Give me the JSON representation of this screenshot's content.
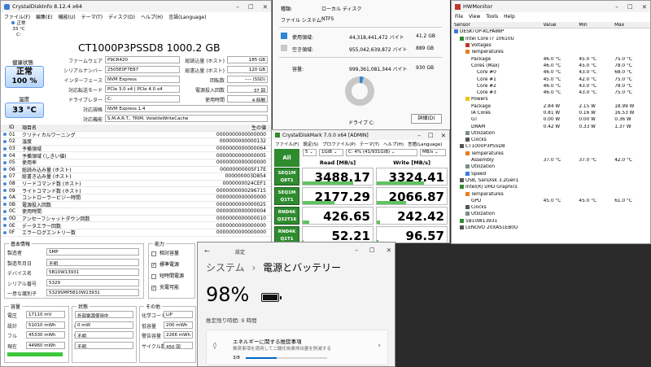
{
  "cdi": {
    "title": "CrystalDiskInfo 8.12.4 x64",
    "menu": [
      "ファイル(F)",
      "編集(E)",
      "機能(U)",
      "テーマ(T)",
      "ディスク(D)",
      "ヘルプ(H)",
      "言語(Language)"
    ],
    "drive_status": "正常",
    "drive_temp": "33 °C",
    "drive_letter": "C:",
    "model": "CT1000P3PSSD8 1000.2 GB",
    "health_label": "健康状態",
    "health_status": "正常",
    "health_pct": "100 %",
    "temp_label": "温度",
    "temp_value": "33 °C",
    "left_fields": [
      {
        "label": "ファームウェア",
        "value": "P9CR420"
      },
      {
        "label": "シリアルナンバー",
        "value": "2505E0F7E87"
      },
      {
        "label": "インターフェース",
        "value": "NVM Express"
      },
      {
        "label": "対応転送モード",
        "value": "PCIe 3.0 x4 | PCIe 4.0 x4"
      },
      {
        "label": "ドライブレター",
        "value": "C:"
      },
      {
        "label": "対応規格",
        "value": "NVM Express 1.4"
      },
      {
        "label": "対応機能",
        "value": "S.M.A.R.T., TRIM, VolatileWriteCache"
      }
    ],
    "right_fields": [
      {
        "label": "総読込量 (ホスト)",
        "value": "185 GB"
      },
      {
        "label": "総書込量 (ホスト)",
        "value": "120 GB"
      },
      {
        "label": "回転数",
        "value": "---- (SSD)"
      },
      {
        "label": "電源投入回数",
        "value": "37 回"
      },
      {
        "label": "使用時間",
        "value": "4 時間"
      }
    ],
    "attr_headers": [
      "ID",
      "項目名",
      "生の値"
    ],
    "attrs": [
      [
        "01",
        "クリティカルワーニング",
        "0000000000000000"
      ],
      [
        "02",
        "温度",
        "000000000000132"
      ],
      [
        "03",
        "予備領域",
        "0000000000000064"
      ],
      [
        "04",
        "予備領域 (しきい値)",
        "0000000000000005"
      ],
      [
        "05",
        "使用率",
        "0000000000000000"
      ],
      [
        "06",
        "総読み込み量 (ホスト)",
        "00000000005F17E"
      ],
      [
        "07",
        "総書き込み量 (ホスト)",
        "000000003D854"
      ],
      [
        "08",
        "リードコマンド数 (ホスト)",
        "0000000024CEF1"
      ],
      [
        "09",
        "ライトコマンド数 (ホスト)",
        "0000000000296715"
      ],
      [
        "0A",
        "コントローラービジー時間",
        "0000000000000000"
      ],
      [
        "0B",
        "電源投入回数",
        "0000000000000025"
      ],
      [
        "0C",
        "使用時間",
        "0000000000000004"
      ],
      [
        "0D",
        "アンセーフシャットダウン回数",
        "0000000000000010"
      ],
      [
        "0E",
        "データエラー回数",
        "0000000000000000"
      ],
      [
        "0F",
        "エラーログエントリー数",
        "0000000000000000"
      ]
    ]
  },
  "battery": {
    "basic_title": "基本情報",
    "basic": [
      {
        "label": "製造者",
        "value": "SMP"
      },
      {
        "label": "製造年月日",
        "value": "不明"
      },
      {
        "label": "デバイス名",
        "value": "5B10W13931"
      },
      {
        "label": "シリアル番号",
        "value": "5329"
      },
      {
        "label": "一意な識別子",
        "value": "5329SMP5B10W13931"
      }
    ],
    "ability_title": "能力",
    "ability": [
      {
        "label": "相対容量",
        "checked": false
      },
      {
        "label": "標準電源",
        "checked": true
      },
      {
        "label": "短時間電源",
        "checked": false
      },
      {
        "label": "充電可能",
        "checked": true
      }
    ],
    "capacity_title": "容量",
    "capacity": [
      {
        "label": "電圧",
        "value": "17110 mV"
      },
      {
        "label": "設計",
        "value": "51010 mWh"
      },
      {
        "label": "フル",
        "value": "45330 mWh"
      },
      {
        "label": "現在",
        "value": "44960 mWh"
      }
    ],
    "state_title": "状態",
    "state": [
      {
        "label": "",
        "value": "外部電源使用中"
      },
      {
        "label": "(放電/充電)速度",
        "value": "0 mW"
      },
      {
        "label": "残り時間",
        "value": "不明"
      },
      {
        "label": "温度",
        "value": "不明"
      }
    ],
    "other_title": "その他",
    "other": [
      {
        "label": "化学コード",
        "value": "LiP"
      },
      {
        "label": "低容量",
        "value": "200 mWh"
      },
      {
        "label": "警告容量",
        "value": "2266 mWh"
      },
      {
        "label": "サイクル数",
        "value": "450 回"
      }
    ]
  },
  "disk_props": {
    "type_label": "種類:",
    "type_value": "ローカル ディスク",
    "fs_label": "ファイル システム:",
    "fs_value": "NTFS",
    "used_label": "使用領域:",
    "used_bytes": "44,318,441,472 バイト",
    "used_gb": "41.2 GB",
    "free_label": "空き領域:",
    "free_bytes": "955,042,639,872 バイト",
    "free_gb": "889 GB",
    "cap_label": "容量:",
    "cap_bytes": "999,361,081,344 バイト",
    "cap_gb": "930 GB",
    "drive_label": "ドライブ C:",
    "detail_button": "詳細(D)",
    "used_color": "#2f86d6",
    "free_color": "#c8c8c8",
    "used_fraction": 0.044
  },
  "hwmon": {
    "title": "HWMonitor",
    "menu": [
      "File",
      "View",
      "Tools",
      "Help"
    ],
    "headers": [
      "Sensor",
      "Value",
      "Min",
      "Max"
    ],
    "rows": [
      {
        "i": 0,
        "n": "DESKTOP-KCPA88P",
        "v": "",
        "mi": "",
        "ma": "",
        "ic": "pc"
      },
      {
        "i": 1,
        "n": "Intel Core i7 10610U",
        "v": "",
        "mi": "",
        "ma": "",
        "ic": "chip"
      },
      {
        "i": 2,
        "n": "Voltages",
        "v": "",
        "mi": "",
        "ma": "",
        "ic": "volt"
      },
      {
        "i": 2,
        "n": "Temperatures",
        "v": "",
        "mi": "",
        "ma": "",
        "ic": "temp"
      },
      {
        "i": 3,
        "n": "Package",
        "v": "46.0 °C",
        "mi": "45.0 °C",
        "ma": "75.0 °C"
      },
      {
        "i": 3,
        "n": "Cores (Max)",
        "v": "46.0 °C",
        "mi": "45.0 °C",
        "ma": "78.0 °C"
      },
      {
        "i": 4,
        "n": "Core #0",
        "v": "46.0 °C",
        "mi": "43.0 °C",
        "ma": "68.0 °C"
      },
      {
        "i": 4,
        "n": "Core #1",
        "v": "45.0 °C",
        "mi": "42.0 °C",
        "ma": "75.0 °C"
      },
      {
        "i": 4,
        "n": "Core #2",
        "v": "46.0 °C",
        "mi": "43.0 °C",
        "ma": "78.0 °C"
      },
      {
        "i": 4,
        "n": "Core #3",
        "v": "46.0 °C",
        "mi": "43.0 °C",
        "ma": "75.0 °C"
      },
      {
        "i": 2,
        "n": "Powers",
        "v": "",
        "mi": "",
        "ma": "",
        "ic": "pow"
      },
      {
        "i": 3,
        "n": "Package",
        "v": "2.84 W",
        "mi": "2.15 W",
        "ma": "18.99 W"
      },
      {
        "i": 3,
        "n": "IA Cores",
        "v": "0.81 W",
        "mi": "0.16 W",
        "ma": "16.53 W"
      },
      {
        "i": 3,
        "n": "GT",
        "v": "0.00 W",
        "mi": "0.00 W",
        "ma": "0.36 W"
      },
      {
        "i": 3,
        "n": "DRAM",
        "v": "0.42 W",
        "mi": "0.33 W",
        "ma": "1.37 W"
      },
      {
        "i": 2,
        "n": "Utilization",
        "v": "",
        "mi": "",
        "ma": "",
        "ic": "util"
      },
      {
        "i": 2,
        "n": "Clocks",
        "v": "",
        "mi": "",
        "ma": "",
        "ic": "clk"
      },
      {
        "i": 1,
        "n": "CT1000P3PSSD8",
        "v": "",
        "mi": "",
        "ma": "",
        "ic": "disk"
      },
      {
        "i": 2,
        "n": "Temperatures",
        "v": "",
        "mi": "",
        "ma": "",
        "ic": "temp"
      },
      {
        "i": 3,
        "n": "Assembly",
        "v": "37.0 °C",
        "mi": "37.0 °C",
        "ma": "42.0 °C"
      },
      {
        "i": 2,
        "n": "Utilization",
        "v": "",
        "mi": "",
        "ma": "",
        "ic": "util"
      },
      {
        "i": 2,
        "n": "Speed",
        "v": "",
        "mi": "",
        "ma": "",
        "ic": "spd"
      },
      {
        "i": 1,
        "n": "USB, SanDisk 3.2Gen1",
        "v": "",
        "mi": "",
        "ma": "",
        "ic": "disk"
      },
      {
        "i": 1,
        "n": "Intel(R) UHD Graphics",
        "v": "",
        "mi": "",
        "ma": "",
        "ic": "gpu"
      },
      {
        "i": 2,
        "n": "Temperatures",
        "v": "",
        "mi": "",
        "ma": "",
        "ic": "temp"
      },
      {
        "i": 3,
        "n": "GPU",
        "v": "45.0 °C",
        "mi": "45.0 °C",
        "ma": "61.0 °C"
      },
      {
        "i": 2,
        "n": "Clocks",
        "v": "",
        "mi": "",
        "ma": "",
        "ic": "clk"
      },
      {
        "i": 2,
        "n": "Utilization",
        "v": "",
        "mi": "",
        "ma": "",
        "ic": "util"
      },
      {
        "i": 1,
        "n": "5B10W13931",
        "v": "",
        "mi": "",
        "ma": "",
        "ic": "bat"
      },
      {
        "i": 1,
        "n": "LENOVO 20XAS1EB0U",
        "v": "",
        "mi": "",
        "ma": "",
        "ic": "board"
      }
    ]
  },
  "cdm": {
    "title": "CrystalDiskMark 7.0.0 x64 [ADMIN]",
    "menu": [
      "ファイル(F)",
      "設定(S)",
      "プロファイル(P)",
      "テーマ(T)",
      "ヘルプ(H)",
      "言語(Language)"
    ],
    "all_button": "All",
    "count": "5",
    "size": "1GiB",
    "drive": "C: 4% (41/931GiB)",
    "unit": "MB/s",
    "read_header": "Read [MB/s]",
    "write_header": "Write [MB/s]",
    "tests": [
      {
        "l1": "SEQ1M",
        "l2": "Q8T1",
        "read": "3488.17",
        "write": "3324.41",
        "rf": 0.72,
        "wf": 0.68
      },
      {
        "l1": "SEQ1M",
        "l2": "Q1T1",
        "read": "2177.29",
        "write": "2066.87",
        "rf": 0.45,
        "wf": 0.42
      },
      {
        "l1": "RND4K",
        "l2": "Q32T16",
        "read": "426.65",
        "write": "242.42",
        "rf": 0.09,
        "wf": 0.05
      },
      {
        "l1": "RND4K",
        "l2": "Q1T1",
        "read": "52.21",
        "write": "96.57",
        "rf": 0.01,
        "wf": 0.02
      }
    ]
  },
  "settings": {
    "app": "設定",
    "breadcrumb_parent": "システム",
    "breadcrumb_sep": "›",
    "page_title": "電源とバッテリー",
    "battery_pct": "98%",
    "battery_fraction": 0.98,
    "remaining": "推定残り時間: 9 時間",
    "rec_title": "エネルギーに関する推奨事項",
    "rec_desc": "推奨事項を適用して二酸化炭素排出量を削減する",
    "rec_progress": "3/8",
    "rec_fraction": 0.375
  }
}
